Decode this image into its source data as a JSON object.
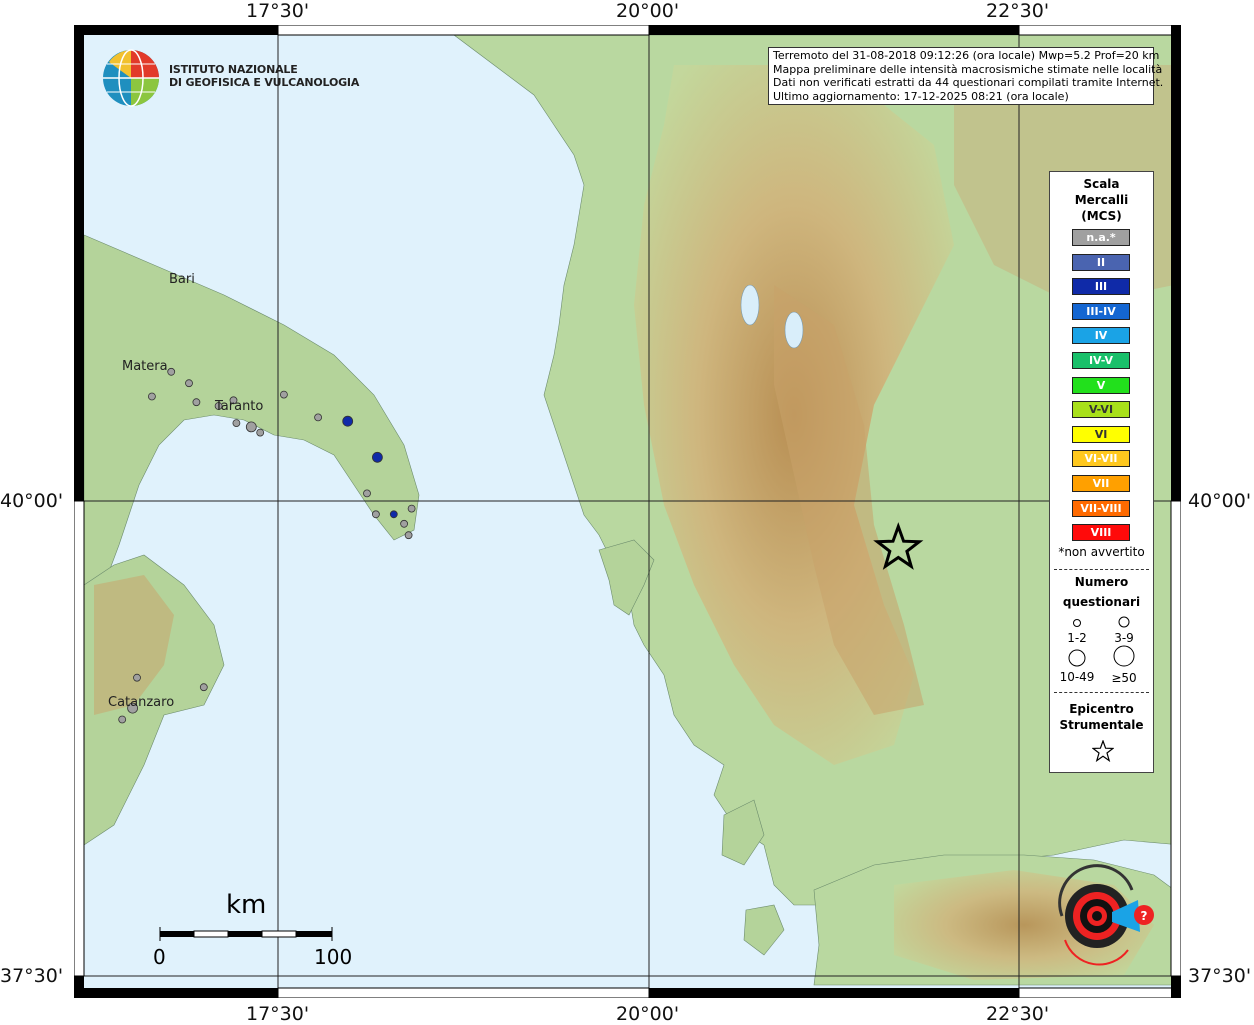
{
  "info": {
    "line1": "Terremoto del 31-08-2018 09:12:26 (ora locale) Mwp=5.2 Prof=20 km",
    "line2": "Mappa preliminare delle intensità macrosismiche stimate nelle località",
    "line3": "Dati non verificati estratti da 44 questionari compilati tramite Internet.",
    "line4": "Ultimo aggiornamento: 17-12-2025 08:21 (ora locale)"
  },
  "institute": {
    "line1": "ISTITUTO NAZIONALE",
    "line2": "DI GEOFISICA E VULCANOLOGIA"
  },
  "ticks": {
    "lon1": "17°30'",
    "lon2": "20°00'",
    "lon3": "22°30'",
    "lat1": "40°00'",
    "lat2": "37°30'"
  },
  "cities": {
    "bari": "Bari",
    "matera": "Matera",
    "taranto": "Taranto",
    "catanzaro": "Catanzaro"
  },
  "scale_bar": {
    "unit": "km",
    "start": "0",
    "end": "100"
  },
  "legend": {
    "title1": "Scala",
    "title2": "Mercalli",
    "title3": "(MCS)",
    "classes": [
      {
        "label": "n.a.*",
        "color": "#a0a0a0"
      },
      {
        "label": "II",
        "color": "#4a64b0"
      },
      {
        "label": "III",
        "color": "#0f2aa8"
      },
      {
        "label": "III-IV",
        "color": "#1466d2"
      },
      {
        "label": "IV",
        "color": "#1aa3e6"
      },
      {
        "label": "IV-V",
        "color": "#19c06a"
      },
      {
        "label": "V",
        "color": "#22e01c"
      },
      {
        "label": "V-VI",
        "color": "#a8e01a"
      },
      {
        "label": "VI",
        "color": "#ffff00"
      },
      {
        "label": "VI-VII",
        "color": "#ffc81e"
      },
      {
        "label": "VII",
        "color": "#ffa000"
      },
      {
        "label": "VII-VIII",
        "color": "#ff6a00"
      },
      {
        "label": "VIII",
        "color": "#ff0a0a"
      }
    ],
    "note": "*non avvertito",
    "count_title1": "Numero",
    "count_title2": "questionari",
    "sizes": [
      "1-2",
      "3-9",
      "10-49",
      "≥50"
    ],
    "epi_title1": "Epicentro",
    "epi_title2": "Strumentale"
  },
  "observations": [
    {
      "lon": 17.54,
      "lat": 40.56,
      "count": "1-2",
      "intensity": "n.a.*"
    },
    {
      "lon": 17.77,
      "lat": 40.44,
      "count": "1-2",
      "intensity": "n.a.*"
    },
    {
      "lon": 17.32,
      "lat": 40.39,
      "count": "3-9",
      "intensity": "n.a.*"
    },
    {
      "lon": 17.2,
      "lat": 40.53,
      "count": "1-2",
      "intensity": "n.a.*"
    },
    {
      "lon": 16.78,
      "lat": 40.68,
      "count": "1-2",
      "intensity": "n.a.*"
    },
    {
      "lon": 16.65,
      "lat": 40.55,
      "count": "1-2",
      "intensity": "n.a.*"
    },
    {
      "lon": 16.9,
      "lat": 40.62,
      "count": "1-2",
      "intensity": "n.a.*"
    },
    {
      "lon": 16.95,
      "lat": 40.52,
      "count": "1-2",
      "intensity": "n.a.*"
    },
    {
      "lon": 17.1,
      "lat": 40.5,
      "count": "1-2",
      "intensity": "n.a.*"
    },
    {
      "lon": 17.38,
      "lat": 40.36,
      "count": "1-2",
      "intensity": "n.a.*"
    },
    {
      "lon": 17.22,
      "lat": 40.41,
      "count": "1-2",
      "intensity": "n.a.*"
    },
    {
      "lon": 17.97,
      "lat": 40.42,
      "count": "3-9",
      "intensity": "III"
    },
    {
      "lon": 18.17,
      "lat": 40.23,
      "count": "3-9",
      "intensity": "III"
    },
    {
      "lon": 18.28,
      "lat": 39.93,
      "count": "1-2",
      "intensity": "III"
    },
    {
      "lon": 18.1,
      "lat": 40.04,
      "count": "1-2",
      "intensity": "n.a.*"
    },
    {
      "lon": 18.16,
      "lat": 39.93,
      "count": "1-2",
      "intensity": "n.a.*"
    },
    {
      "lon": 18.4,
      "lat": 39.96,
      "count": "1-2",
      "intensity": "n.a.*"
    },
    {
      "lon": 18.35,
      "lat": 39.88,
      "count": "1-2",
      "intensity": "n.a.*"
    },
    {
      "lon": 18.38,
      "lat": 39.82,
      "count": "1-2",
      "intensity": "n.a.*"
    },
    {
      "lon": 16.52,
      "lat": 38.91,
      "count": "3-9",
      "intensity": "n.a.*"
    },
    {
      "lon": 16.45,
      "lat": 38.85,
      "count": "1-2",
      "intensity": "n.a.*"
    },
    {
      "lon": 16.55,
      "lat": 39.07,
      "count": "1-2",
      "intensity": "n.a.*"
    },
    {
      "lon": 16.05,
      "lat": 39.62,
      "count": "1-2",
      "intensity": "n.a.*"
    },
    {
      "lon": 17.0,
      "lat": 39.02,
      "count": "1-2",
      "intensity": "n.a.*"
    }
  ],
  "epicenter": {
    "lon": 21.68,
    "lat": 39.75
  }
}
